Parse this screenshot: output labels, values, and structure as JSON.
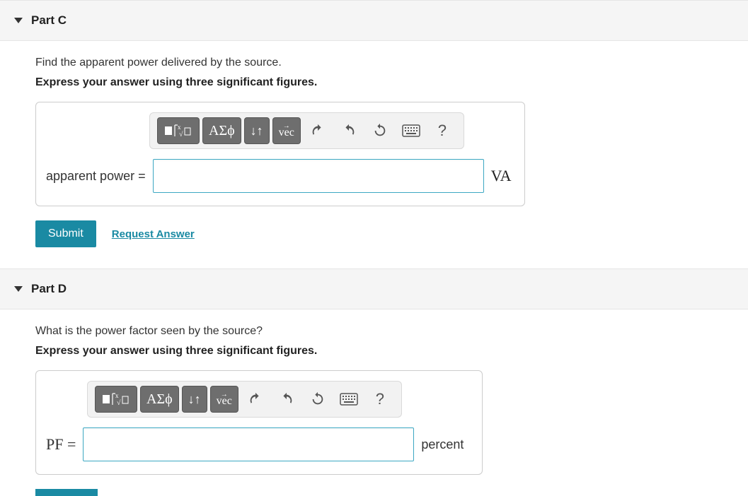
{
  "partC": {
    "title": "Part C",
    "question": "Find the apparent power delivered by the source.",
    "instruction": "Express your answer using three significant figures.",
    "var_label": "apparent power =",
    "unit": "VA",
    "submit": "Submit",
    "request_answer": "Request Answer"
  },
  "partD": {
    "title": "Part D",
    "question": "What is the power factor seen by the source?",
    "instruction": "Express your answer using three significant figures.",
    "var_label": "PF =",
    "unit": "percent"
  },
  "toolbar": {
    "vec_label": "vec",
    "greek_label": "ΑΣϕ",
    "arrows_label": "↓↑",
    "help_label": "?"
  }
}
